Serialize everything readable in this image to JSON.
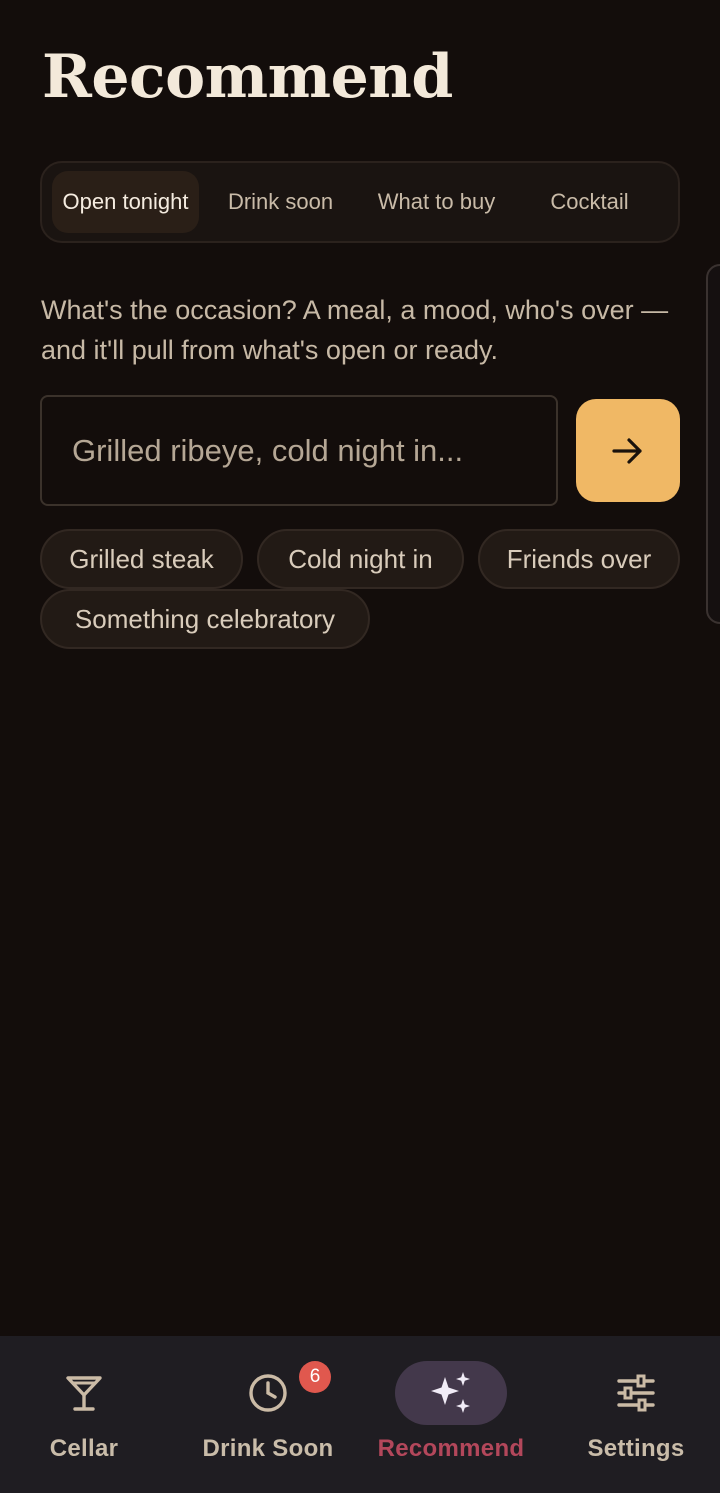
{
  "header": {
    "title": "Recommend"
  },
  "mode_tabs": [
    {
      "label": "Open tonight",
      "active": true
    },
    {
      "label": "Drink soon",
      "active": false
    },
    {
      "label": "What to buy",
      "active": false
    },
    {
      "label": "Cocktail",
      "active": false
    }
  ],
  "intro_text": "What's the occasion? A meal, a mood, who's over — and it'll pull from what's open or ready.",
  "search": {
    "placeholder": "Grilled ribeye, cold night in...",
    "value": ""
  },
  "submit": {
    "icon": "arrow-right-icon"
  },
  "suggestions": [
    "Grilled steak",
    "Cold night in",
    "Friends over",
    "Something celebratory"
  ],
  "nav": {
    "items": [
      {
        "label": "Cellar",
        "icon": "cocktail-glass-icon",
        "active": false
      },
      {
        "label": "Drink Soon",
        "icon": "clock-icon",
        "active": false,
        "badge": "6"
      },
      {
        "label": "Recommend",
        "icon": "sparkles-icon",
        "active": true
      },
      {
        "label": "Settings",
        "icon": "sliders-icon",
        "active": false
      }
    ]
  },
  "colors": {
    "background": "#130d0b",
    "accent": "#f0b865",
    "active_nav": "#b3475b",
    "badge": "#e0584e"
  }
}
